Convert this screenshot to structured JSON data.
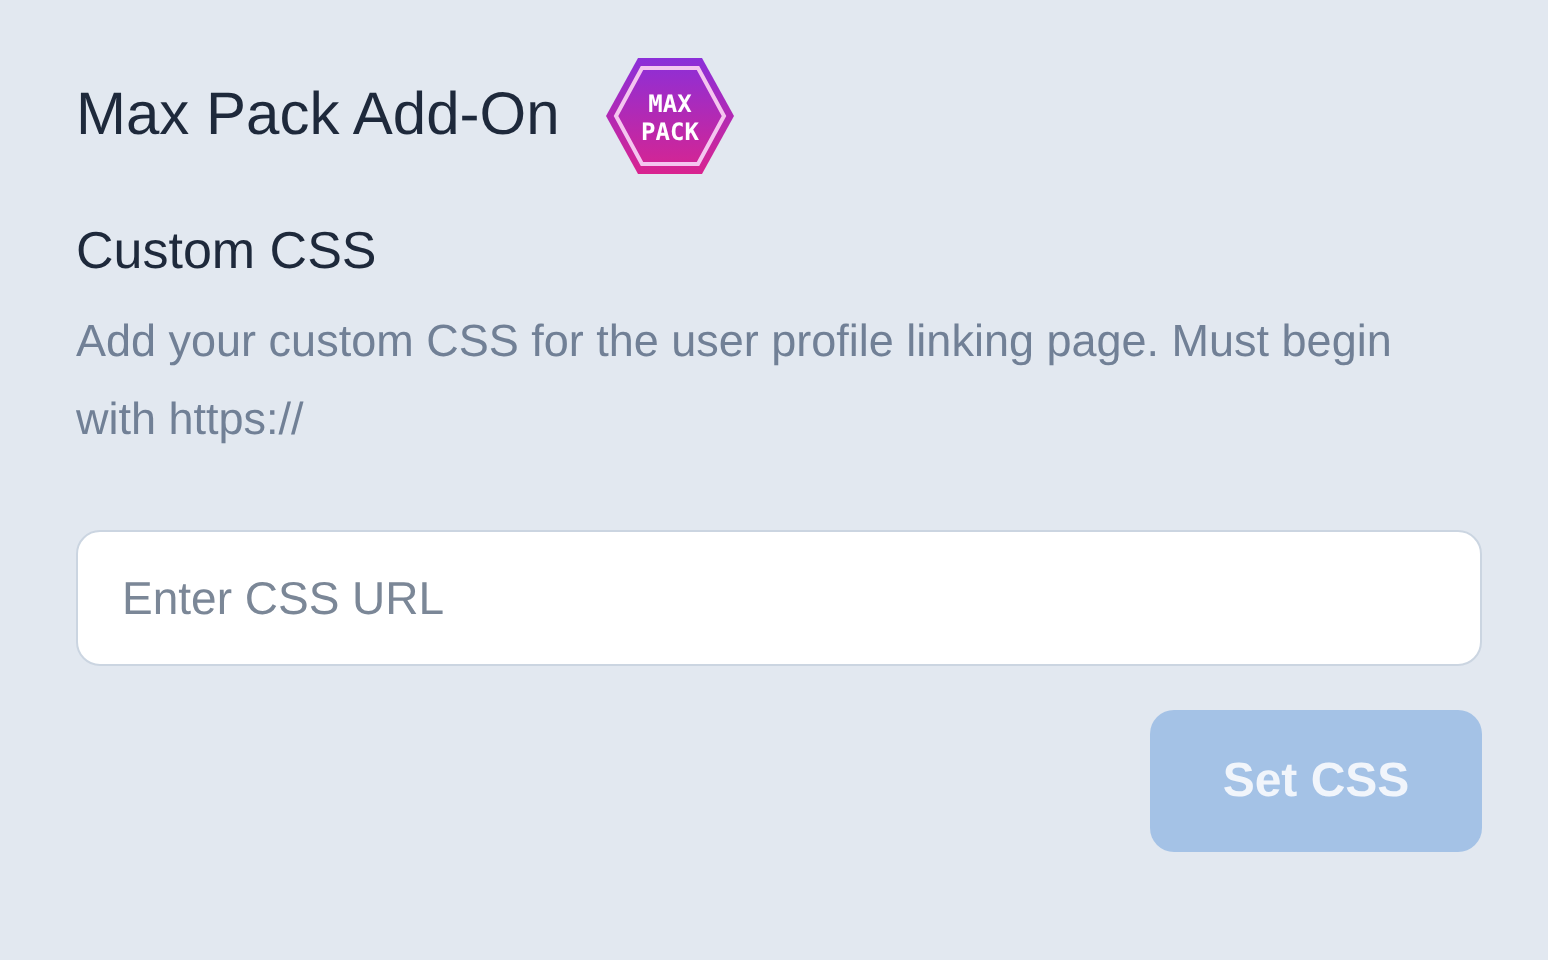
{
  "title": "Max Pack Add-On",
  "badge": {
    "lines": [
      "MAX",
      "PACK"
    ]
  },
  "section": {
    "heading": "Custom CSS",
    "description": "Add your custom CSS for the user profile linking page. Must begin with https://"
  },
  "input": {
    "placeholder": "Enter CSS URL"
  },
  "button": {
    "label": "Set CSS",
    "disabled": true
  }
}
